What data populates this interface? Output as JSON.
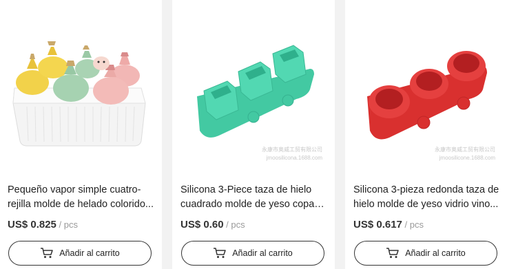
{
  "products": [
    {
      "title_line1": "Pequeño vapor simple cuatro-",
      "title_line2": "rejilla molde de helado colorido...",
      "price": "US$ 0.825",
      "unit": " / pcs",
      "button_label": "Añadir al carrito",
      "watermark_line1": "",
      "watermark_line2": "",
      "image_icon": "popsicle-mold-image"
    },
    {
      "title_line1": "Silicona 3-Piece taza de hielo",
      "title_line2": "cuadrado molde de yeso copa d...",
      "price": "US$ 0.60",
      "unit": " / pcs",
      "button_label": "Añadir al carrito",
      "watermark_line1": "永康市奥威工贸有限公司",
      "watermark_line2": "jmoosilicona.1688.com",
      "image_icon": "square-ice-cup-mold-image"
    },
    {
      "title_line1": "Silicona 3-pieza redonda taza de",
      "title_line2": "hielo molde de yeso vidrio vino...",
      "price": "US$ 0.617",
      "unit": " / pcs",
      "button_label": "Añadir al carrito",
      "watermark_line1": "永康市奥威工贸有限公司",
      "watermark_line2": "jmoosilicone.1688.com",
      "image_icon": "round-ice-cup-mold-image"
    }
  ],
  "colors": {
    "mold_white": "#f4f4f4",
    "mold_yellow": "#f2d24a",
    "mold_green": "#a9d3b3",
    "mold_pink": "#f2b7b5",
    "mint": "#4fd6b0",
    "red": "#e2383b"
  },
  "icons": {
    "cart": "cart-icon"
  }
}
